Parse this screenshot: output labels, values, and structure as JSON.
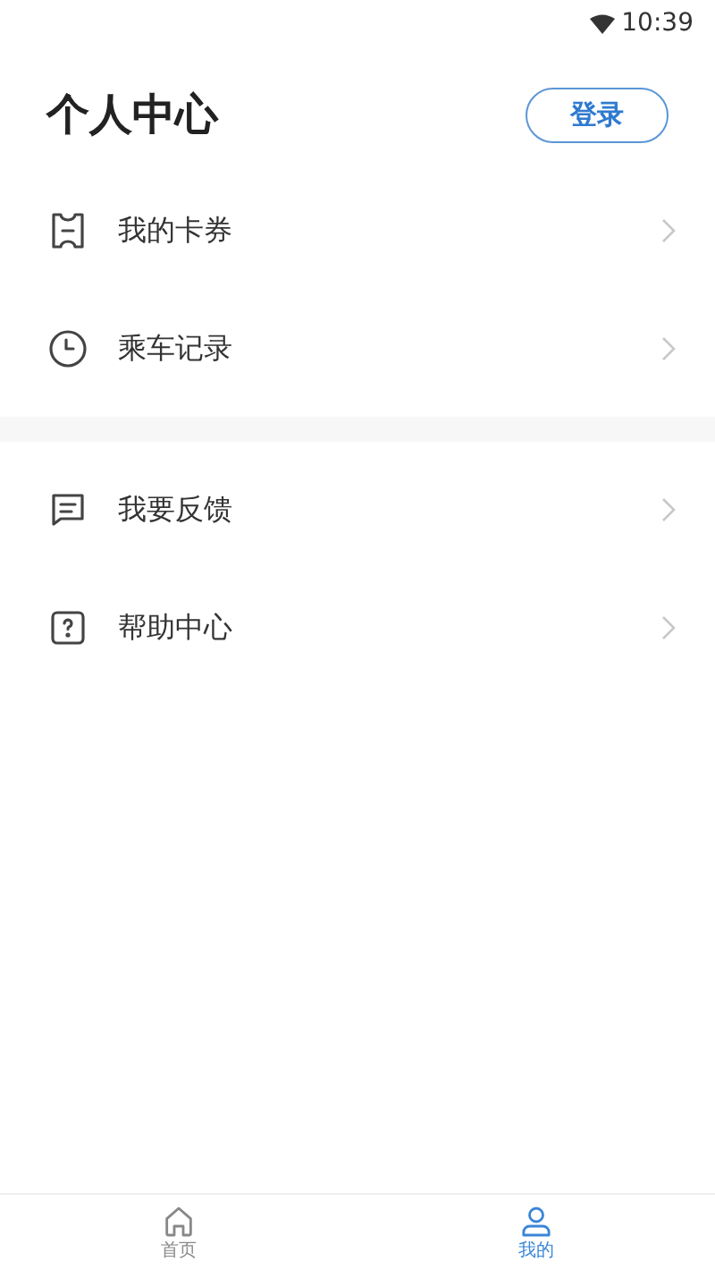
{
  "status_bar": {
    "time": "10:39"
  },
  "header": {
    "title": "个人中心",
    "login_button": "登录"
  },
  "sections": [
    {
      "items": [
        {
          "kind": "ticket",
          "label": "我的卡券"
        },
        {
          "kind": "clock",
          "label": "乘车记录"
        }
      ]
    },
    {
      "items": [
        {
          "kind": "feedback",
          "label": "我要反馈"
        },
        {
          "kind": "help",
          "label": "帮助中心"
        }
      ]
    }
  ],
  "tab_bar": [
    {
      "kind": "home",
      "label": "首页",
      "selected": false
    },
    {
      "kind": "user",
      "label": "我的",
      "selected": true
    }
  ]
}
